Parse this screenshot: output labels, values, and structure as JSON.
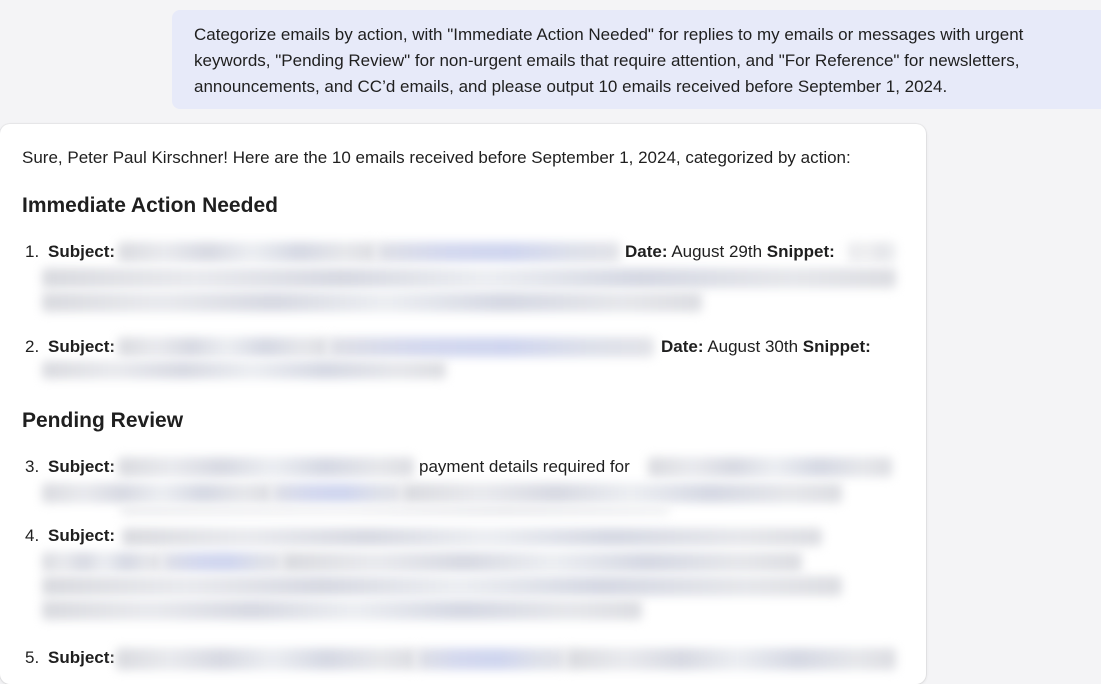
{
  "user_message": {
    "text": "Categorize emails by action, with \"Immediate Action Needed\" for replies to my emails or messages with urgent keywords, \"Pending Review\" for non-urgent emails that require attention, and \"For Reference\" for newsletters, announcements, and CC’d emails, and please output 10 emails received before September 1, 2024."
  },
  "reply": {
    "intro": "Sure, Peter Paul Kirschner! Here are the 10 emails received before September 1, 2024, categorized by action:",
    "sections": [
      {
        "heading": "Immediate Action Needed",
        "items": [
          {
            "number": "1.",
            "subject_label": "Subject:",
            "date_label": "Date:",
            "date": "August 29th",
            "snippet_label": "Snippet:"
          },
          {
            "number": "2.",
            "subject_label": "Subject:",
            "date_label": "Date:",
            "date": "August 30th",
            "snippet_label": "Snippet:"
          }
        ]
      },
      {
        "heading": "Pending Review",
        "items": [
          {
            "number": "3.",
            "subject_label": "Subject:",
            "visible_text": "payment details required for"
          },
          {
            "number": "4.",
            "subject_label": "Subject:"
          },
          {
            "number": "5.",
            "subject_label": "Subject:"
          }
        ]
      }
    ]
  },
  "colors": {
    "page_background": "#f4f4f6",
    "user_bubble": "#e7eaf9",
    "card_background": "#ffffff",
    "text": "#1f1f1f"
  }
}
